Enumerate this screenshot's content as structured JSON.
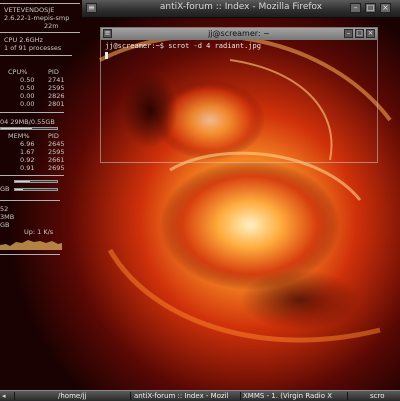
{
  "window": {
    "title": "antiX-forum :: Index - Mozilla Firefox"
  },
  "terminal": {
    "title": "jj@screamer: ~",
    "prompt": "jj@screamer:~$ scrot -d 4 radiant.jpg"
  },
  "conky": {
    "hostname": "VETEVENDOSJE",
    "kernel": "2.6.22-1-mepis-smp",
    "uptime": "22m",
    "cpu": "CPU 2.6GHz",
    "processes": "1 of 91  processes",
    "cpu_header": {
      "pct": "CPU%",
      "pid": "PID"
    },
    "cpu_rows": [
      {
        "pct": "0.50",
        "pid": "2741"
      },
      {
        "pct": "0.50",
        "pid": "2595"
      },
      {
        "pct": "0.00",
        "pid": "2826"
      },
      {
        "pct": "0.00",
        "pid": "2801"
      }
    ],
    "mem": "04 29MB/0.55GB",
    "mem_header": {
      "pct": "MEM%",
      "pid": "PID"
    },
    "mem_rows": [
      {
        "pct": "6.96",
        "pid": "2645"
      },
      {
        "pct": "1.67",
        "pid": "2595"
      },
      {
        "pct": "0.92",
        "pid": "2661"
      },
      {
        "pct": "0.91",
        "pid": "2695"
      }
    ],
    "disk_label": "GB",
    "disk_fill": 0.35,
    "net_a": "52",
    "net_b": "3MB",
    "net_c": "GB",
    "net_rate": "Up: 1   K/s"
  },
  "taskbar": {
    "items": [
      "/home/jj",
      "antiX-forum :: Index - Mozil",
      "XMMS - 1. (Virgin Radio X"
    ],
    "right": "scro"
  }
}
